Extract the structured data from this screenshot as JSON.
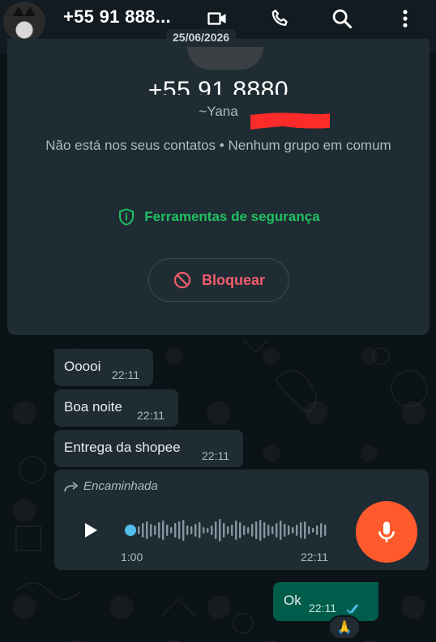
{
  "header": {
    "title": "+55 91 888...",
    "icons": [
      "video-icon",
      "phone-icon",
      "search-icon",
      "more-vert-icon"
    ]
  },
  "info_card": {
    "name": "+55 91 8880",
    "date": "25/06/2026",
    "alias": "~Yana",
    "note": "Não está nos seus contatos • Nenhum grupo em comum",
    "security_label": "Ferramentas de segurança",
    "block_label": "Bloquear"
  },
  "messages": [
    {
      "text": "Ooooi",
      "time": "22:11"
    },
    {
      "text": "Boa noite",
      "time": "22:11"
    },
    {
      "text": "Entrega da shopee",
      "time": "22:11"
    }
  ],
  "voice_message": {
    "forwarded_label": "Encaminhada",
    "duration": "1:00",
    "time": "22:11",
    "progress": 0
  },
  "outgoing": {
    "text": "Ok",
    "time": "22:11",
    "reaction": "🙏"
  },
  "colors": {
    "accent_green": "#21c063",
    "block_red": "#f15c6d",
    "mic_orange": "#ff5a2c",
    "outgoing_bubble": "#005c4b",
    "incoming_bubble": "#202c33",
    "read_ticks": "#53bdeb"
  }
}
